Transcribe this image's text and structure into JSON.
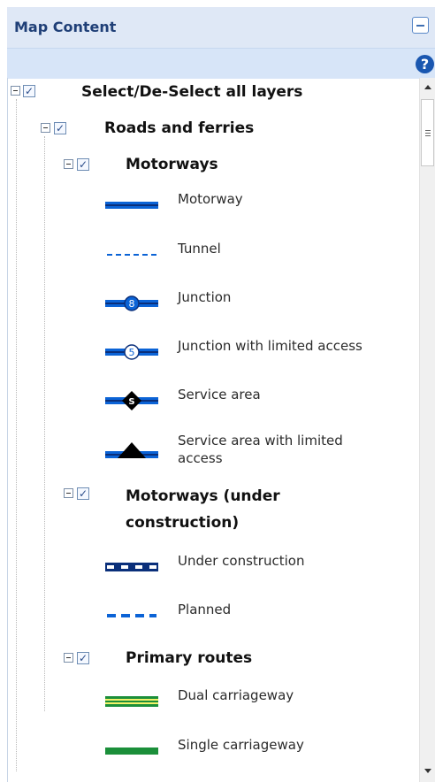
{
  "panel": {
    "title": "Map Content",
    "collapse_icon": "collapse-icon",
    "help_icon": "?"
  },
  "tree": {
    "root_label": "Select/De-Select all layers",
    "groups": [
      {
        "label": "Roads and ferries",
        "subgroups": [
          {
            "label": "Motorways",
            "items": [
              {
                "label": "Motorway",
                "symbol": "motorway-symbol"
              },
              {
                "label": "Tunnel",
                "symbol": "tunnel-symbol"
              },
              {
                "label": "Junction",
                "symbol": "junction-symbol",
                "badge": "8"
              },
              {
                "label": "Junction with limited access",
                "symbol": "junction-limited-symbol",
                "badge": "5"
              },
              {
                "label": "Service area",
                "symbol": "service-area-symbol",
                "badge": "S"
              },
              {
                "label": "Service area with limited access",
                "symbol": "service-area-limited-symbol"
              }
            ]
          },
          {
            "label": "Motorways (under construction)",
            "items": [
              {
                "label": "Under construction",
                "symbol": "under-construction-symbol"
              },
              {
                "label": "Planned",
                "symbol": "planned-symbol"
              }
            ]
          },
          {
            "label": "Primary routes",
            "items": [
              {
                "label": "Dual carriageway",
                "symbol": "dual-carriageway-symbol"
              },
              {
                "label": "Single carriageway",
                "symbol": "single-carriageway-symbol"
              }
            ]
          }
        ]
      }
    ]
  },
  "colors": {
    "header_bg": "#dfe8f6",
    "toolbar_bg": "#d7e5f8",
    "motorway_blue": "#0b63d6",
    "motorway_dark": "#0a2f7a",
    "primary_green": "#1b8f3a",
    "primary_yellow": "#f3f16a"
  }
}
